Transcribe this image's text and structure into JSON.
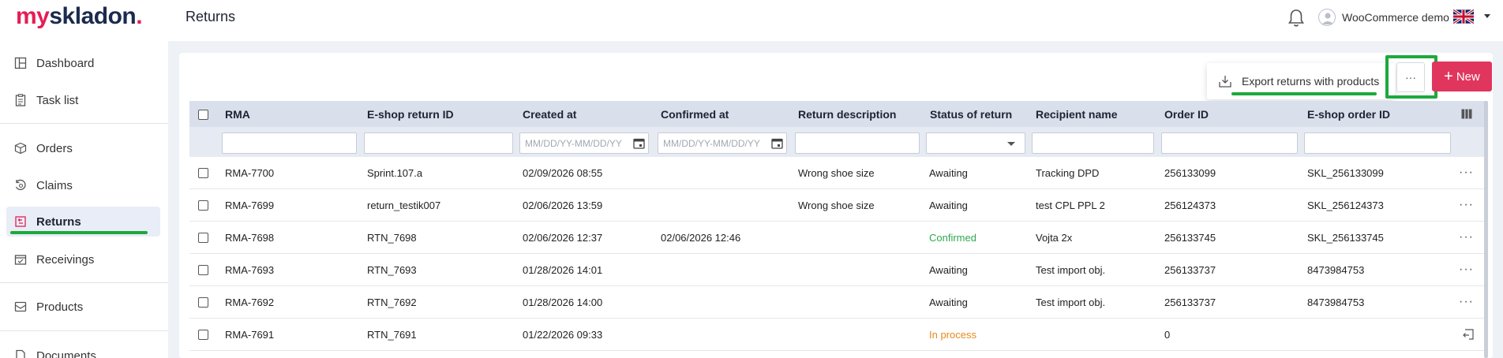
{
  "app": {
    "logo_part1": "my",
    "logo_part2": "skladon",
    "logo_dot": ".",
    "page_title": "Returns",
    "user_name": "WooCommerce demo"
  },
  "sidebar": {
    "items": [
      {
        "label": "Dashboard",
        "icon": "dashboard-icon"
      },
      {
        "label": "Task list",
        "icon": "task-list-icon"
      },
      {
        "label": "Orders",
        "icon": "box-icon"
      },
      {
        "label": "Claims",
        "icon": "claims-icon"
      },
      {
        "label": "Returns",
        "icon": "return-icon",
        "active": true
      },
      {
        "label": "Receivings",
        "icon": "receiving-icon"
      },
      {
        "label": "Products",
        "icon": "products-icon"
      },
      {
        "label": "Documents",
        "icon": "documents-icon"
      }
    ]
  },
  "toolbar": {
    "export_label": "Export returns with products",
    "more_label": "···",
    "new_label": "New",
    "new_plus": "+"
  },
  "table": {
    "columns": [
      "RMA",
      "E-shop return ID",
      "Created at",
      "Confirmed at",
      "Return description",
      "Status of return",
      "Recipient name",
      "Order ID",
      "E-shop order ID"
    ],
    "date_placeholder": "MM/DD/YY-MM/DD/YY",
    "rows": [
      {
        "rma": "RMA-7700",
        "eshop_return_id": "Sprint.107.a",
        "created": "02/09/2026 08:55",
        "confirmed": "",
        "description": "Wrong shoe size",
        "status": "Awaiting",
        "recipient": "Tracking DPD",
        "order_id": "256133099",
        "eshop_order_id": "SKL_256133099"
      },
      {
        "rma": "RMA-7699",
        "eshop_return_id": "return_testik007",
        "created": "02/06/2026 13:59",
        "confirmed": "",
        "description": "Wrong shoe size",
        "status": "Awaiting",
        "recipient": "test CPL PPL 2",
        "order_id": "256124373",
        "eshop_order_id": "SKL_256124373"
      },
      {
        "rma": "RMA-7698",
        "eshop_return_id": "RTN_7698",
        "created": "02/06/2026 12:37",
        "confirmed": "02/06/2026 12:46",
        "description": "",
        "status": "Confirmed",
        "recipient": "Vojta 2x",
        "order_id": "256133745",
        "eshop_order_id": "SKL_256133745"
      },
      {
        "rma": "RMA-7693",
        "eshop_return_id": "RTN_7693",
        "created": "01/28/2026 14:01",
        "confirmed": "",
        "description": "",
        "status": "Awaiting",
        "recipient": "Test import obj.",
        "order_id": "256133737",
        "eshop_order_id": "8473984753"
      },
      {
        "rma": "RMA-7692",
        "eshop_return_id": "RTN_7692",
        "created": "01/28/2026 14:00",
        "confirmed": "",
        "description": "",
        "status": "Awaiting",
        "recipient": "Test import obj.",
        "order_id": "256133737",
        "eshop_order_id": "8473984753"
      },
      {
        "rma": "RMA-7691",
        "eshop_return_id": "RTN_7691",
        "created": "01/22/2026 09:33",
        "confirmed": "",
        "description": "",
        "status": "In process",
        "recipient": "",
        "order_id": "0",
        "eshop_order_id": ""
      }
    ]
  },
  "colors": {
    "brand": "#e41e54",
    "new_button": "#e0365d",
    "highlight_green": "#1ca93e",
    "status_confirmed": "#2fa84f",
    "status_in_process": "#e68a1c"
  }
}
